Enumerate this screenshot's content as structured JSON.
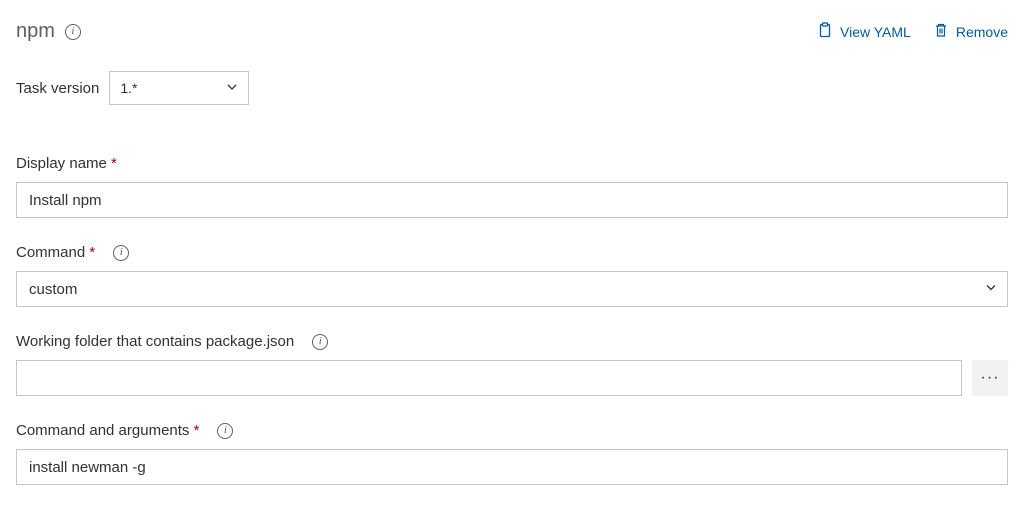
{
  "header": {
    "title": "npm",
    "view_yaml_label": "View YAML",
    "remove_label": "Remove"
  },
  "task_version": {
    "label": "Task version",
    "selected": "1.*"
  },
  "fields": {
    "display_name": {
      "label": "Display name",
      "required": "*",
      "value": "Install npm"
    },
    "command": {
      "label": "Command",
      "required": "*",
      "selected": "custom"
    },
    "working_folder": {
      "label": "Working folder that contains package.json",
      "value": ""
    },
    "command_args": {
      "label": "Command and arguments",
      "required": "*",
      "value": "install newman -g"
    }
  }
}
